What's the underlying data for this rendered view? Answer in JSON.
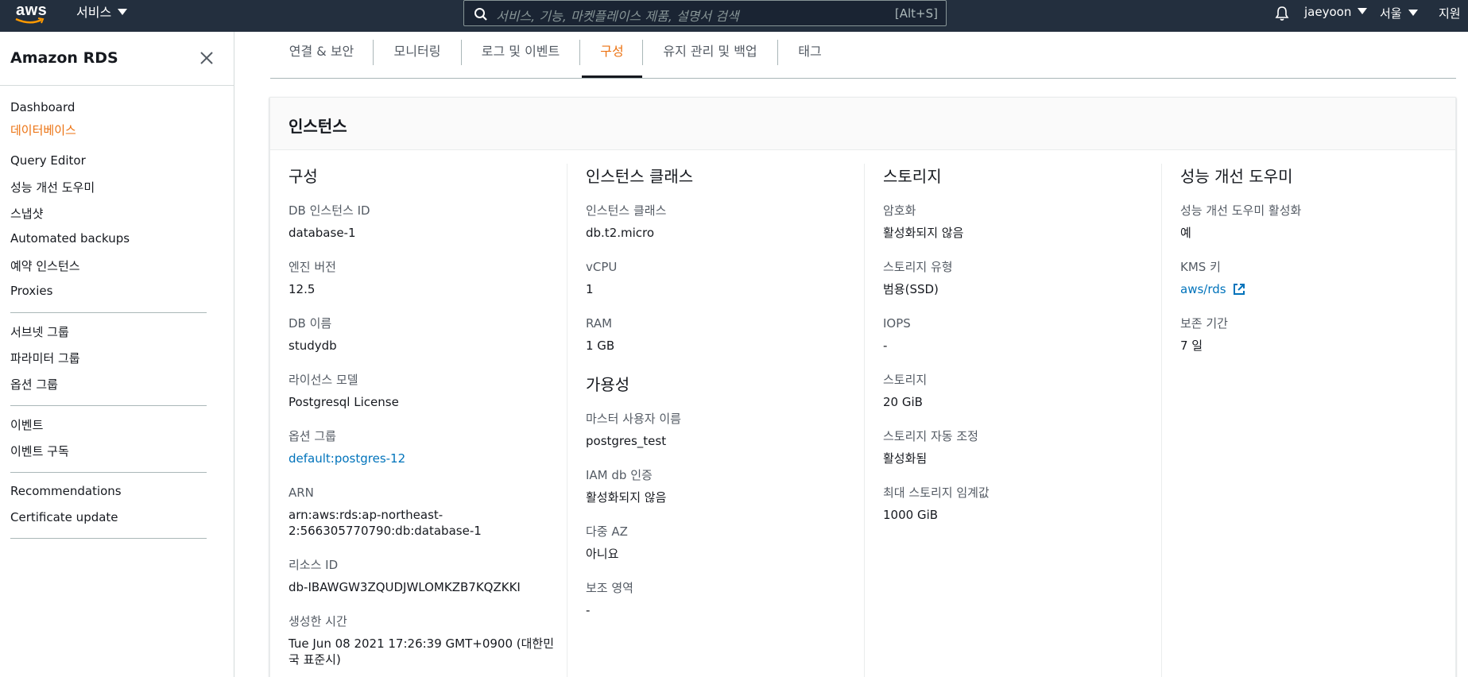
{
  "topbar": {
    "logo": "aws",
    "services_label": "서비스",
    "search_placeholder": "서비스, 기능, 마켓플레이스 제품, 설명서 검색",
    "search_shortcut": "[Alt+S]",
    "user": "jaeyoon",
    "region": "서울",
    "support": "지원"
  },
  "sidebar": {
    "title": "Amazon RDS",
    "items": [
      {
        "label": "Dashboard",
        "active": false
      },
      {
        "label": "데이터베이스",
        "active": true
      },
      {
        "label": "Query Editor",
        "active": false
      },
      {
        "label": "성능 개선 도우미",
        "active": false
      },
      {
        "label": "스냅샷",
        "active": false
      },
      {
        "label": "Automated backups",
        "active": false
      },
      {
        "label": "예약 인스턴스",
        "active": false
      },
      {
        "label": "Proxies",
        "active": false
      },
      {
        "label": "서브넷 그룹",
        "active": false
      },
      {
        "label": "파라미터 그룹",
        "active": false
      },
      {
        "label": "옵션 그룹",
        "active": false
      },
      {
        "label": "이벤트",
        "active": false
      },
      {
        "label": "이벤트 구독",
        "active": false
      },
      {
        "label": "Recommendations",
        "active": false
      },
      {
        "label": "Certificate update",
        "active": false
      }
    ]
  },
  "tabs": [
    {
      "label": "연결 & 보안",
      "active": false
    },
    {
      "label": "모니터링",
      "active": false
    },
    {
      "label": "로그 및 이벤트",
      "active": false
    },
    {
      "label": "구성",
      "active": true
    },
    {
      "label": "유지 관리 및 백업",
      "active": false
    },
    {
      "label": "태그",
      "active": false
    }
  ],
  "panel": {
    "title": "인스턴스",
    "config": {
      "heading": "구성",
      "db_instance_id": {
        "key": "DB 인스턴스 ID",
        "value": "database-1"
      },
      "engine_version": {
        "key": "엔진 버전",
        "value": "12.5"
      },
      "db_name": {
        "key": "DB 이름",
        "value": "studydb"
      },
      "license_model": {
        "key": "라이선스 모델",
        "value": "Postgresql License"
      },
      "option_group": {
        "key": "옵션 그룹",
        "value": "default:postgres-12"
      },
      "arn": {
        "key": "ARN",
        "value_line1": "arn:aws:rds:ap-northeast-",
        "value_line2": "2:566305770790:db:database-1"
      },
      "resource_id": {
        "key": "리소스 ID",
        "value": "db-IBAWGW3ZQUDJWLOMKZB7KQZKKI"
      },
      "created_time": {
        "key": "생성한 시간",
        "value_line1": "Tue Jun 08 2021 17:26:39 GMT+0900 (대한민",
        "value_line2": "국 표준시)"
      }
    },
    "instance_class": {
      "heading": "인스턴스 클래스",
      "class": {
        "key": "인스턴스 클래스",
        "value": "db.t2.micro"
      },
      "vcpu": {
        "key": "vCPU",
        "value": "1"
      },
      "ram": {
        "key": "RAM",
        "value": "1 GB"
      }
    },
    "availability": {
      "heading": "가용성",
      "master_user": {
        "key": "마스터 사용자 이름",
        "value": "postgres_test"
      },
      "iam_auth": {
        "key": "IAM db 인증",
        "value": "활성화되지 않음"
      },
      "multi_az": {
        "key": "다중 AZ",
        "value": "아니요"
      },
      "secondary_zone": {
        "key": "보조 영역",
        "value": "-"
      }
    },
    "storage": {
      "heading": "스토리지",
      "encryption": {
        "key": "암호화",
        "value": "활성화되지 않음"
      },
      "type": {
        "key": "스토리지 유형",
        "value": "범용(SSD)"
      },
      "iops": {
        "key": "IOPS",
        "value": "-"
      },
      "storage": {
        "key": "스토리지",
        "value": "20 GiB"
      },
      "autoscaling": {
        "key": "스토리지 자동 조정",
        "value": "활성화됨"
      },
      "max_threshold": {
        "key": "최대 스토리지 임계값",
        "value": "1000 GiB"
      }
    },
    "performance_insights": {
      "heading": "성능 개선 도우미",
      "enabled": {
        "key": "성능 개선 도우미 활성화",
        "value": "예"
      },
      "kms_key": {
        "key": "KMS 키",
        "value": "aws/rds"
      },
      "retention": {
        "key": "보존 기간",
        "value": "7 일"
      }
    }
  },
  "colors": {
    "topbar_bg": "#232f3e",
    "accent_orange": "#ec7211",
    "link_blue": "#0073bb"
  }
}
